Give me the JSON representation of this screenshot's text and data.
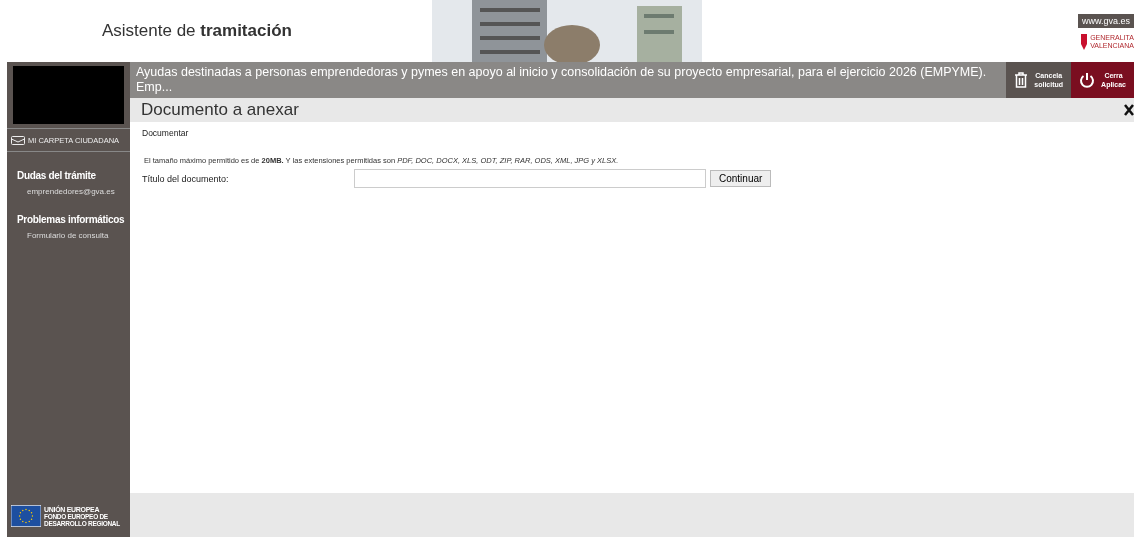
{
  "header": {
    "title": "Asistente de **tramitación**",
    "site_link": "www.gva.es",
    "logo_lines": [
      "GENERALITA",
      "VALENCIANA"
    ]
  },
  "sidebar": {
    "folder_link": "MI CARPETA CIUDADANA",
    "sections": [
      {
        "heading": "Dudas del trámite",
        "link": "emprendedores@gva.es"
      },
      {
        "heading": "Problemas informáticos",
        "link": "Formulario de consulta"
      }
    ],
    "eu_logo": {
      "lines": [
        "UNIÓN EUROPEA",
        "FONDO EUROPEO DE",
        "DESARROLLO REGIONAL"
      ]
    }
  },
  "procedure_bar": {
    "title": "Ayudas destinadas a personas emprendedoras y pymes en apoyo al inicio y consolidación de su proyecto empresarial, para el ejercicio 2026 (EMPYME). Emp...",
    "actions": [
      {
        "kind": "cancel",
        "lines": [
          "Cancela",
          "solicitud"
        ]
      },
      {
        "kind": "close",
        "lines": [
          "Cerra",
          "Aplicac"
        ]
      }
    ]
  },
  "page_title": "Documento a anexar",
  "section_label": "Documentar",
  "info": "El tamaño máximo permitido es de **20MB.** Y las extensiones permitidas son *PDF, DOC, DOCX, XLS, ODT, ZIP, RAR, ODS, XML, JPG y XLSX.*",
  "form": {
    "label": "Título del documento:",
    "button": "Continuar"
  }
}
